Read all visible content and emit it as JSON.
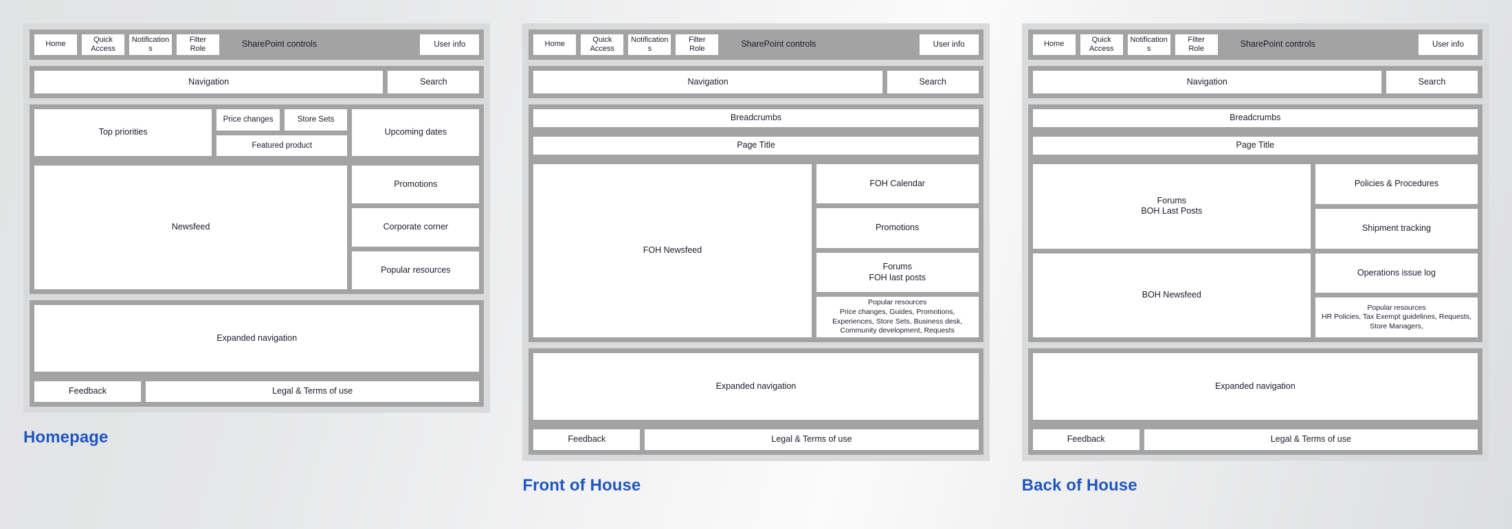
{
  "colors": {
    "frame_gray": "#a3a3a3",
    "panel_bg": "#d9dadb",
    "cell_white": "#ffffff",
    "caption_blue": "#1f56c4",
    "text": "#1b1b2a"
  },
  "panels": [
    {
      "caption": "Homepage",
      "header": {
        "buttons": [
          "Home",
          "Quick\nAccess",
          "Notification\ns",
          "Filter\nRole"
        ],
        "label": "SharePoint controls",
        "user": "User info"
      },
      "nav": {
        "main": "Navigation",
        "search": "Search"
      },
      "body": {
        "top_priorities": "Top priorities",
        "price_changes": "Price changes",
        "store_sets": "Store Sets",
        "featured_product": "Featured product",
        "upcoming_dates": "Upcoming dates",
        "newsfeed": "Newsfeed",
        "promotions": "Promotions",
        "corporate_corner": "Corporate corner",
        "popular_resources": "Popular resources"
      },
      "footer": {
        "expanded_navigation": "Expanded navigation",
        "feedback": "Feedback",
        "legal": "Legal & Terms of use"
      }
    },
    {
      "caption": "Front of House",
      "header": {
        "buttons": [
          "Home",
          "Quick\nAccess",
          "Notification\ns",
          "Filter\nRole"
        ],
        "label": "SharePoint controls",
        "user": "User info"
      },
      "nav": {
        "main": "Navigation",
        "search": "Search"
      },
      "body": {
        "breadcrumbs": "Breadcrumbs",
        "page_title": "Page Title",
        "main": "FOH Newsfeed",
        "side": [
          "FOH Calendar",
          "Promotions",
          "Forums\nFOH last posts",
          "Popular resources\nPrice changes, Guides, Promotions, Experiences, Store Sets, Business desk, Community development, Requests"
        ]
      },
      "footer": {
        "expanded_navigation": "Expanded navigation",
        "feedback": "Feedback",
        "legal": "Legal & Terms of use"
      }
    },
    {
      "caption": "Back of House",
      "header": {
        "buttons": [
          "Home",
          "Quick\nAccess",
          "Notification\ns",
          "Filter\nRole"
        ],
        "label": "SharePoint controls",
        "user": "User info"
      },
      "nav": {
        "main": "Navigation",
        "search": "Search"
      },
      "body": {
        "breadcrumbs": "Breadcrumbs",
        "page_title": "Page Title",
        "main": [
          "Forums\nBOH Last Posts",
          "BOH Newsfeed"
        ],
        "side": [
          "Policies & Procedures",
          "Shipment tracking",
          "Operations issue log",
          "Popular resources\nHR Policies, Tax Exempt guidelines, Requests, Store Managers,"
        ]
      },
      "footer": {
        "expanded_navigation": "Expanded navigation",
        "feedback": "Feedback",
        "legal": "Legal & Terms of use"
      }
    }
  ]
}
